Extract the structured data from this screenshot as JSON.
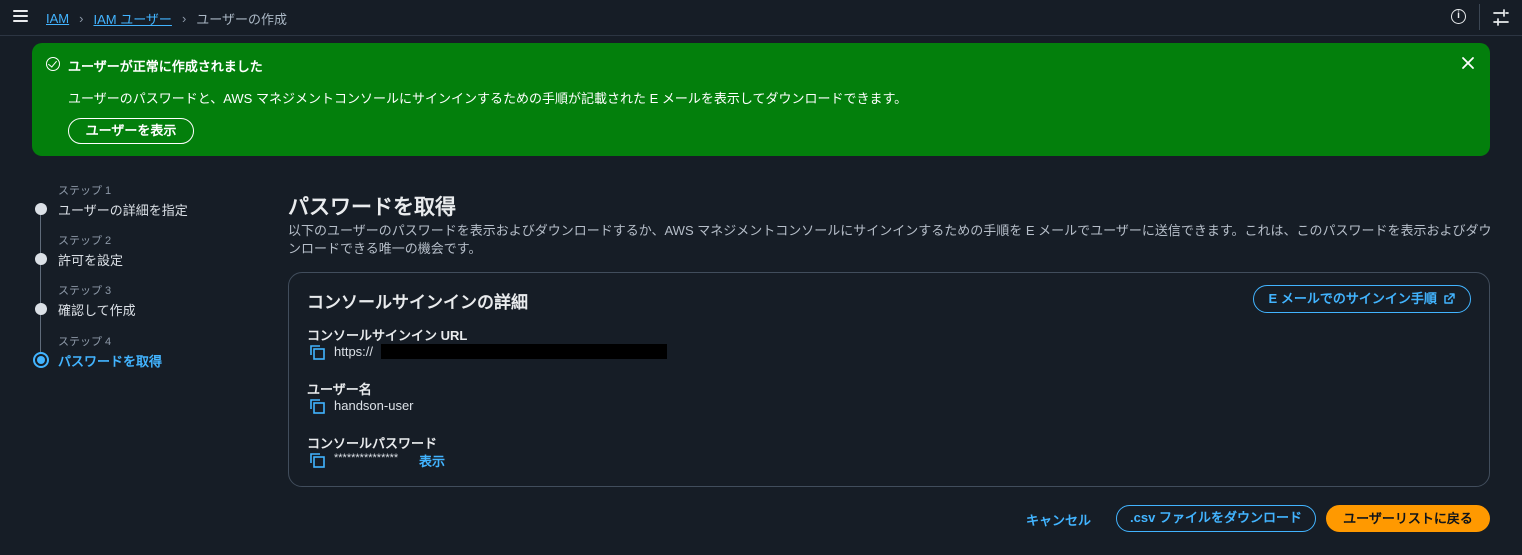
{
  "topbar": {
    "breadcrumb": [
      {
        "label": "IAM"
      },
      {
        "label": "IAM ユーザー"
      },
      {
        "label": "ユーザーの作成"
      }
    ],
    "info_icon": "info-icon",
    "panel_icon": "split-panel-icon"
  },
  "flash": {
    "status": "success",
    "title": "ユーザーが正常に作成されました",
    "message": "ユーザーのパスワードと、AWS マネジメントコンソールにサインインするための手順が記載された E メールを表示してダウンロードできます。",
    "button_label": "ユーザーを表示",
    "color": "#037f0c"
  },
  "steps": [
    {
      "label": "ステップ 1",
      "title": "ユーザーの詳細を指定"
    },
    {
      "label": "ステップ 2",
      "title": "許可を設定"
    },
    {
      "label": "ステップ 3",
      "title": "確認して作成"
    },
    {
      "label": "ステップ 4",
      "title": "パスワードを取得",
      "active": true
    }
  ],
  "main": {
    "title": "パスワードを取得",
    "description": "以下のユーザーのパスワードを表示およびダウンロードするか、AWS マネジメントコンソールにサインインするための手順を E メールでユーザーに送信できます。これは、このパスワードを表示およびダウンロードできる唯一の機会です。"
  },
  "card": {
    "title": "コンソールサインインの詳細",
    "email_button_label": "E メールでのサインイン手順",
    "fields": [
      {
        "label": "コンソールサインイン URL",
        "value": "https://"
      },
      {
        "label": "ユーザー名",
        "value": "handson-user"
      },
      {
        "label": "コンソールパスワード",
        "value": "***************"
      }
    ],
    "show_label": "表示"
  },
  "footer": {
    "cancel_label": "キャンセル",
    "csv_label": ".csv ファイルをダウンロード",
    "primary_label": "ユーザーリストに戻る"
  },
  "colors": {
    "accent": "#42b4ff",
    "primary_button": "#ff9900",
    "background": "#161d26"
  }
}
